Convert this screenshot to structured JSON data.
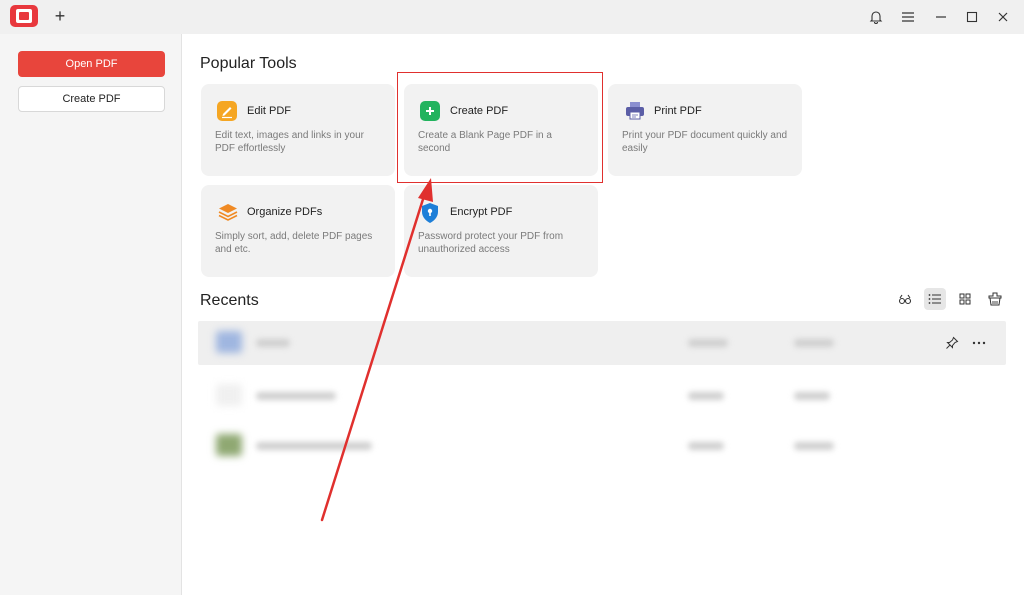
{
  "sidebar": {
    "open_pdf_label": "Open PDF",
    "create_pdf_label": "Create PDF"
  },
  "main": {
    "popular_tools_title": "Popular Tools",
    "recents_title": "Recents",
    "tools": [
      {
        "name": "Edit PDF",
        "desc": "Edit text, images and links in your PDF effortlessly",
        "icon": "edit-icon",
        "color": "#f5a623"
      },
      {
        "name": "Create PDF",
        "desc": "Create a Blank Page PDF in a second",
        "icon": "plus-icon",
        "color": "#22b35e"
      },
      {
        "name": "Print PDF",
        "desc": "Print your PDF document quickly and easily",
        "icon": "printer-icon",
        "color": "#5b5ea6"
      },
      {
        "name": "Organize PDFs",
        "desc": "Simply sort, add, delete PDF pages and etc.",
        "icon": "layers-icon",
        "color": "#f08a24"
      },
      {
        "name": "Encrypt PDF",
        "desc": "Password protect your PDF from unauthorized access",
        "icon": "shield-lock-icon",
        "color": "#1e7fd8"
      }
    ]
  },
  "titlebar": {
    "new_tab_symbol": "+"
  },
  "colors": {
    "brand": "#e8453c",
    "highlight": "#e0302e",
    "arrow": "#e0302e"
  }
}
